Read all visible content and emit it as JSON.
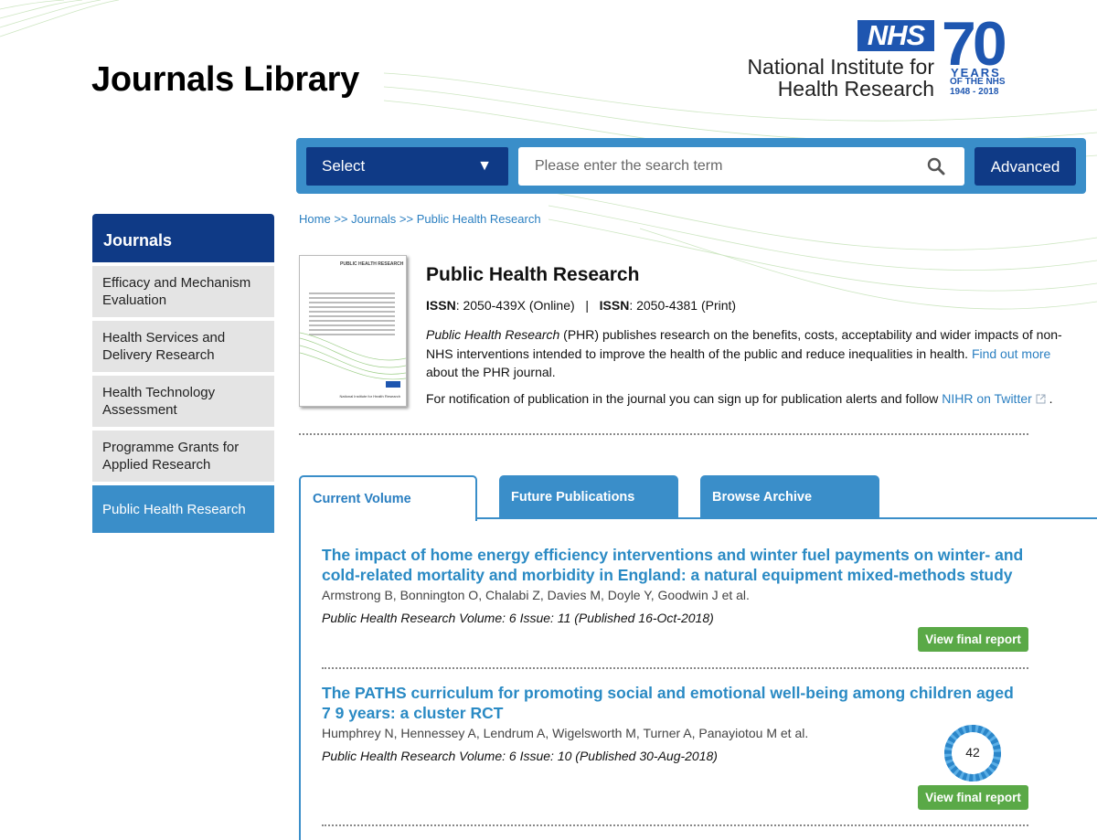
{
  "site": {
    "title": "Journals Library"
  },
  "logo": {
    "nhs": "NHS",
    "line1": "National Institute for",
    "line2": "Health Research",
    "seventy": "70",
    "years": "YEARS",
    "of_nhs": "OF THE NHS",
    "range": "1948 - 2018"
  },
  "search": {
    "select_label": "Select",
    "select_arrow": "▼",
    "placeholder": "Please enter the search term",
    "advanced_label": "Advanced"
  },
  "sidebar": {
    "header": "Journals",
    "items": [
      {
        "label": "Efficacy and Mechanism Evaluation"
      },
      {
        "label": "Health Services and Delivery Research"
      },
      {
        "label": "Health Technology Assessment"
      },
      {
        "label": "Programme Grants for Applied Research"
      },
      {
        "label": "Public Health Research"
      }
    ]
  },
  "breadcrumb": {
    "home": "Home",
    "sep": ">>",
    "journals": "Journals",
    "current": "Public Health Research"
  },
  "cover": {
    "title": "PUBLIC HEALTH RESEARCH",
    "niher": "National Institute for Health Research"
  },
  "journal": {
    "title": "Public Health Research",
    "issn_label": "ISSN",
    "issn_online": ": 2050-439X (Online)",
    "issn_sep": "|",
    "issn_print": ": 2050-4381 (Print)",
    "desc_italic": "Public Health Research",
    "desc_text": " (PHR) publishes research on the benefits, costs, acceptability and wider impacts of non-NHS interventions intended to improve the health of the public and reduce inequalities in health. ",
    "find_out_more": "Find out more",
    "desc_tail": " about the PHR journal.",
    "notify_text": "For notification of publication in the journal you can sign up for publication alerts and follow ",
    "notify_link": "NIHR on Twitter",
    "notify_tail": "."
  },
  "tabs": [
    {
      "label": "Current Volume"
    },
    {
      "label": "Future Publications"
    },
    {
      "label": "Browse Archive"
    }
  ],
  "articles": [
    {
      "title": "The impact of home energy efficiency interventions and winter fuel payments on winter- and cold-related mortality and morbidity in England: a natural equipment mixed-methods study",
      "authors": "Armstrong B, Bonnington O, Chalabi Z, Davies M, Doyle Y, Goodwin J et al.",
      "meta": "Public Health Research Volume: 6 Issue: 11 (Published 16-Oct-2018)",
      "button": "View final report"
    },
    {
      "title": "The PATHS curriculum for promoting social and emotional well-being among children aged 7 9 years: a cluster RCT",
      "authors": "Humphrey N, Hennessey A, Lendrum A, Wigelsworth M, Turner A, Panayiotou M et al.",
      "meta": "Public Health Research Volume: 6 Issue: 10 (Published 30-Aug-2018)",
      "button": "View final report",
      "altmetric_score": "42"
    }
  ],
  "colors": {
    "nhs_blue": "#1e56b0",
    "navy": "#0f3a86",
    "accent_blue": "#3a8ec9",
    "link_blue": "#2a7fc1",
    "green_button": "#5aa947"
  }
}
